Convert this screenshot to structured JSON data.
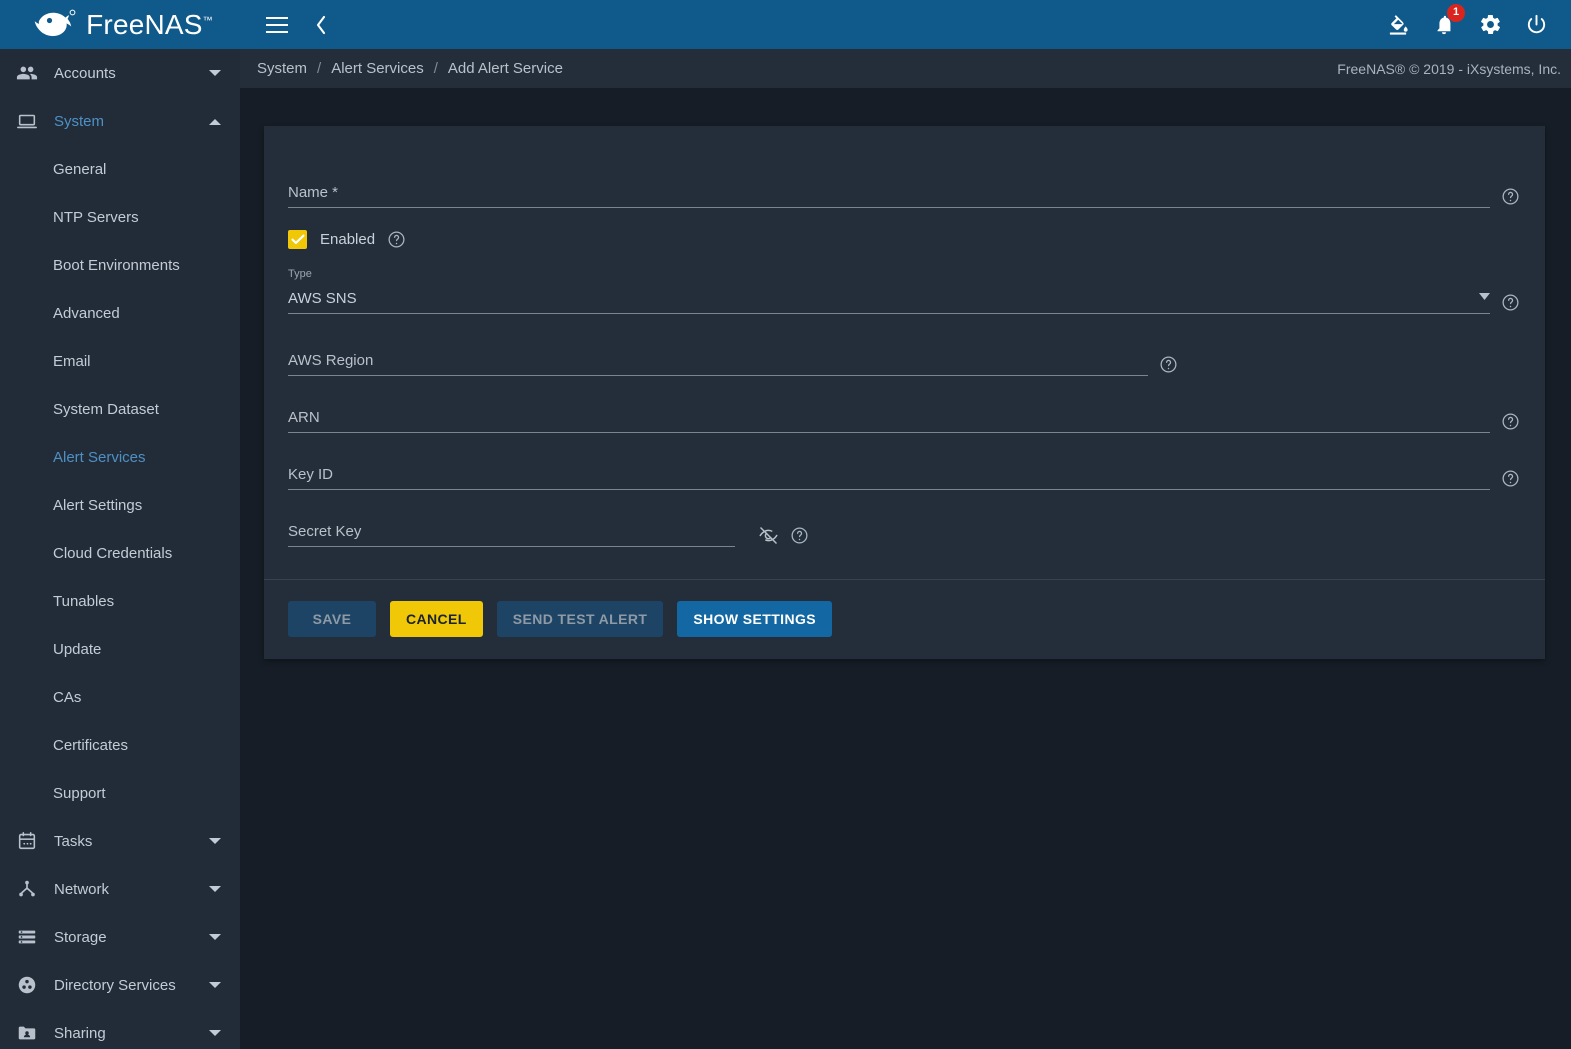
{
  "brand": {
    "name": "FreeNAS",
    "trademark": "™",
    "logo_icon": "freenas-fish-logo"
  },
  "topbar": {
    "menu_icon": "hamburger-menu-icon",
    "back_icon": "chevron-left-icon",
    "theme_icon": "color-fill-icon",
    "alerts_icon": "bell-icon",
    "alerts_count": "1",
    "settings_icon": "gear-icon",
    "power_icon": "power-icon"
  },
  "breadcrumb": {
    "items": [
      "System",
      "Alert Services",
      "Add Alert Service"
    ],
    "separator": "/"
  },
  "footer_note": "FreeNAS® © 2019 - iXsystems, Inc.",
  "sidebar": {
    "groups": [
      {
        "label": "Accounts",
        "icon": "people-icon",
        "expanded": false,
        "chevron": "chevron-down-icon",
        "active": false,
        "children": []
      },
      {
        "label": "System",
        "icon": "laptop-icon",
        "expanded": true,
        "chevron": "chevron-up-icon",
        "active": true,
        "children": [
          {
            "label": "General",
            "selected": false
          },
          {
            "label": "NTP Servers",
            "selected": false
          },
          {
            "label": "Boot Environments",
            "selected": false
          },
          {
            "label": "Advanced",
            "selected": false
          },
          {
            "label": "Email",
            "selected": false
          },
          {
            "label": "System Dataset",
            "selected": false
          },
          {
            "label": "Alert Services",
            "selected": true
          },
          {
            "label": "Alert Settings",
            "selected": false
          },
          {
            "label": "Cloud Credentials",
            "selected": false
          },
          {
            "label": "Tunables",
            "selected": false
          },
          {
            "label": "Update",
            "selected": false
          },
          {
            "label": "CAs",
            "selected": false
          },
          {
            "label": "Certificates",
            "selected": false
          },
          {
            "label": "Support",
            "selected": false
          }
        ]
      },
      {
        "label": "Tasks",
        "icon": "calendar-icon",
        "expanded": false,
        "chevron": "chevron-down-icon",
        "active": false,
        "children": []
      },
      {
        "label": "Network",
        "icon": "network-icon",
        "expanded": false,
        "chevron": "chevron-down-icon",
        "active": false,
        "children": []
      },
      {
        "label": "Storage",
        "icon": "storage-icon",
        "expanded": false,
        "chevron": "chevron-down-icon",
        "active": false,
        "children": []
      },
      {
        "label": "Directory Services",
        "icon": "directory-services-icon",
        "expanded": false,
        "chevron": "chevron-down-icon",
        "active": false,
        "children": []
      },
      {
        "label": "Sharing",
        "icon": "shared-folder-icon",
        "expanded": false,
        "chevron": "chevron-down-icon",
        "active": false,
        "children": []
      }
    ]
  },
  "form": {
    "name": {
      "label": "Name *",
      "value": "",
      "help_icon": "help-circle-icon"
    },
    "enabled": {
      "label": "Enabled",
      "checked": true,
      "help_icon": "help-circle-icon"
    },
    "type": {
      "mini_label": "Type",
      "value": "AWS SNS",
      "arrow_icon": "dropdown-arrow-icon",
      "help_icon": "help-circle-icon"
    },
    "aws_region": {
      "label": "AWS Region",
      "value": "",
      "help_icon": "help-circle-icon"
    },
    "arn": {
      "label": "ARN",
      "value": "",
      "help_icon": "help-circle-icon"
    },
    "key_id": {
      "label": "Key ID",
      "value": "",
      "help_icon": "help-circle-icon"
    },
    "secret_key": {
      "label": "Secret Key",
      "value": "",
      "visibility_icon": "eye-off-icon",
      "help_icon": "help-circle-icon"
    }
  },
  "actions": {
    "save": "SAVE",
    "cancel": "CANCEL",
    "send_test_alert": "SEND TEST ALERT",
    "show_settings": "SHOW SETTINGS"
  },
  "colors": {
    "header_blue": "#0f5a8a",
    "sidebar_bg": "#222c38",
    "page_bg": "#161d26",
    "card_bg": "#242e3a",
    "accent_yellow": "#f0c808",
    "primary_blue": "#1368a3",
    "link_blue": "#4e90c4",
    "badge_red": "#d9251d"
  }
}
